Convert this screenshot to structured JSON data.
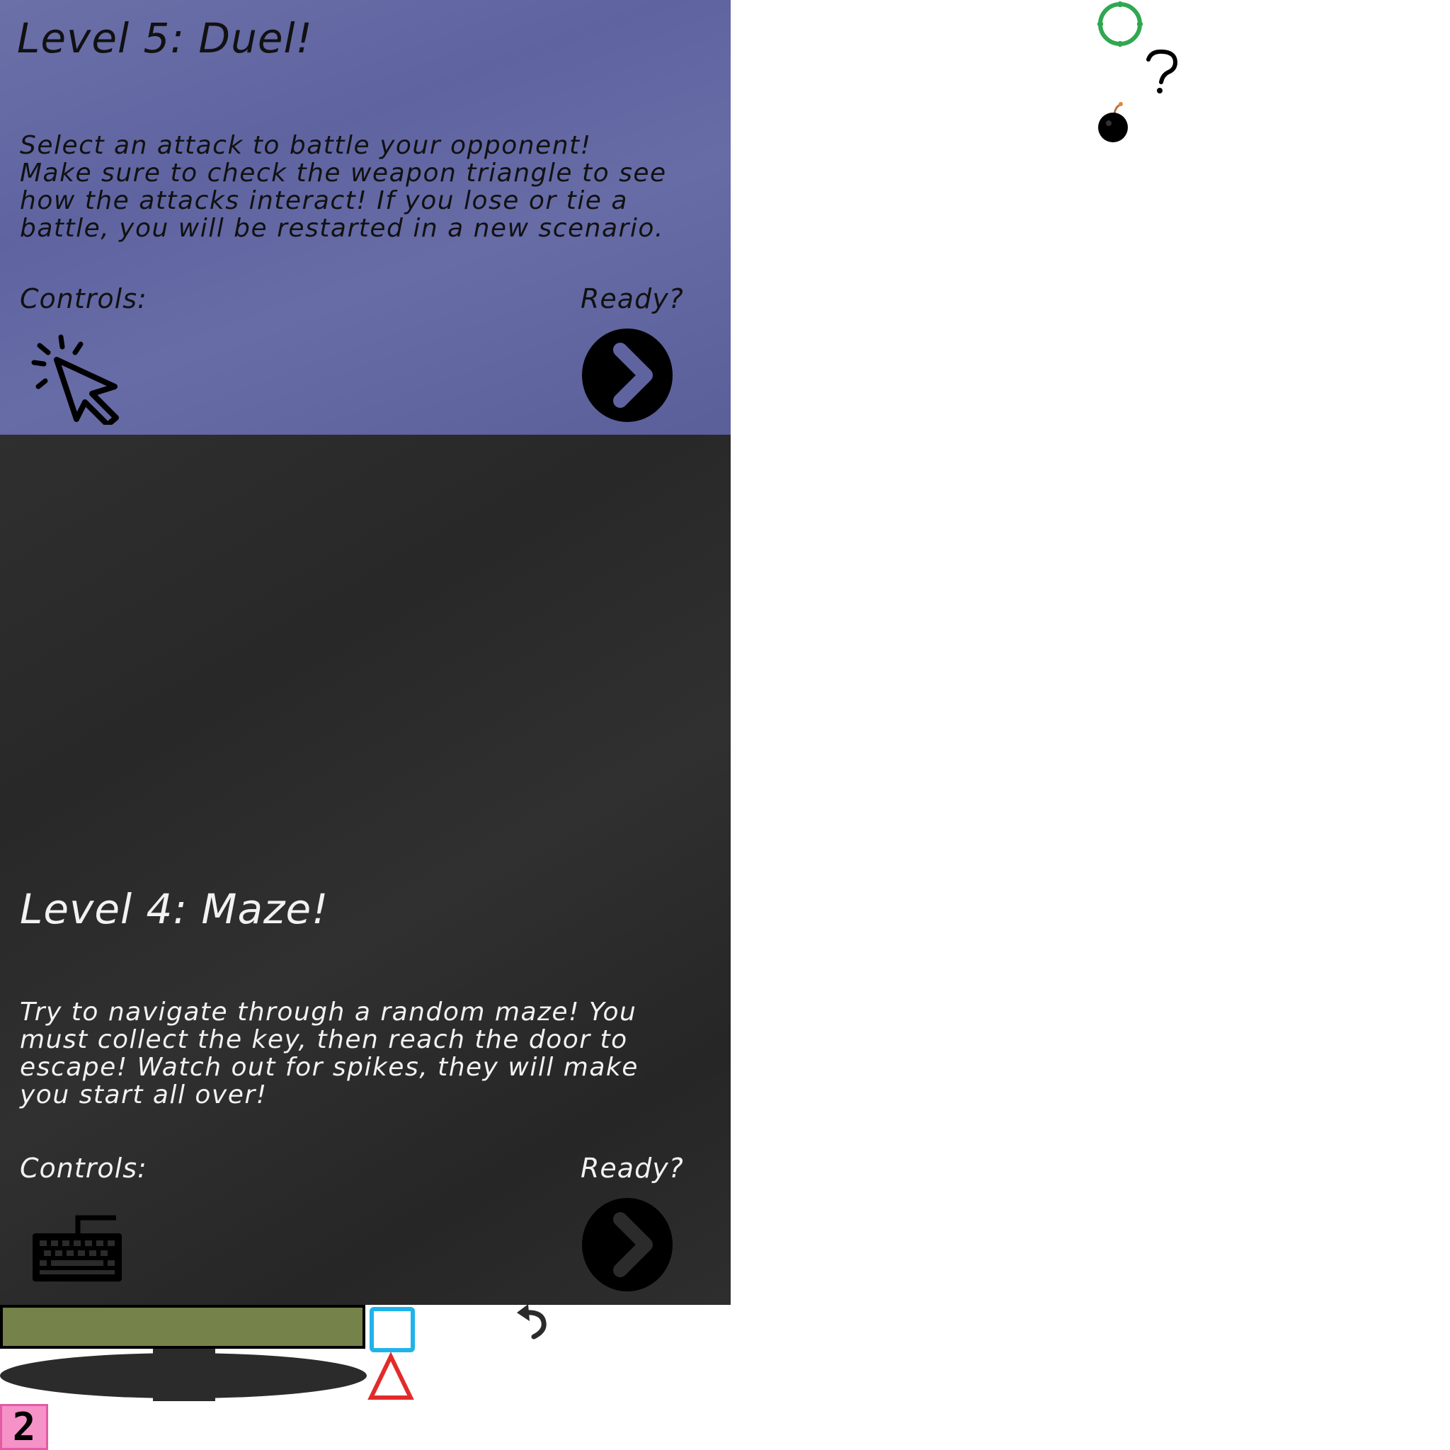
{
  "levels": [
    {
      "title": "Level 5: Duel!",
      "description": "Select an attack to battle your opponent!\nMake sure to check the weapon triangle to see\nhow the attacks interact! If you lose or tie a\nbattle, you will be restarted in a new scenario.",
      "controls_label": "Controls:",
      "ready_label": "Ready?",
      "controls_icon": "mouse-click-icon"
    },
    {
      "title": "Level 4: Maze!",
      "description": "Try to navigate through a random maze! You\nmust collect the key, then reach the door to\nescape! Watch out for spikes, they will make\nyou start all over!",
      "controls_label": "Controls:",
      "ready_label": "Ready?",
      "controls_icon": "keyboard-icon"
    }
  ],
  "hud": {
    "counter_value": "2"
  },
  "colors": {
    "level5_panel": "#6266a2",
    "level4_panel": "#2b2b2b",
    "health_bar": "#758249",
    "target_ring": "#2fa84f",
    "square_outline": "#1fb3ea",
    "triangle_outline": "#e32a2a",
    "counter_bg": "#f592c8"
  }
}
